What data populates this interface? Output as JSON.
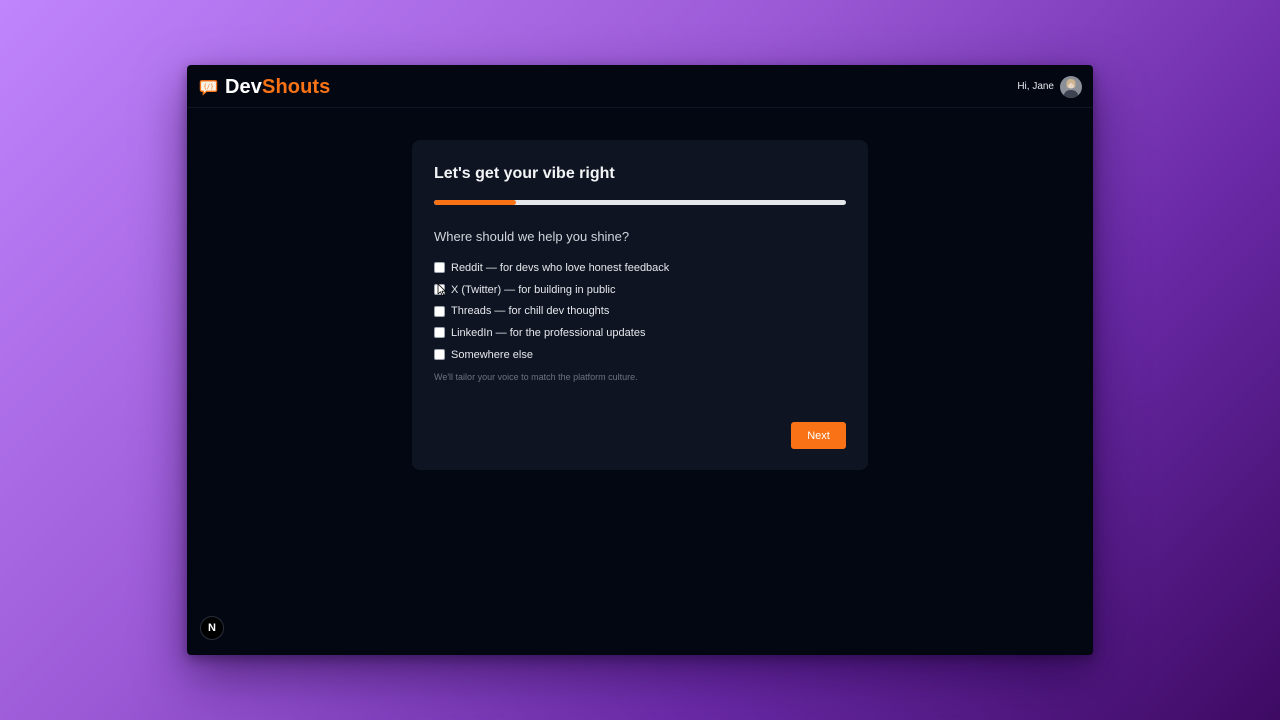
{
  "header": {
    "brand_part1": "Dev",
    "brand_part2": "Shouts",
    "brand_icon": "speech-bubble-code-icon",
    "greeting": "Hi, Jane",
    "avatar_icon": "user-avatar"
  },
  "onboarding": {
    "title": "Let's get your vibe right",
    "progress": 0.2,
    "question": "Where should we help you shine?",
    "options": [
      {
        "label": "Reddit — for devs who love honest feedback",
        "checked": false
      },
      {
        "label": "X (Twitter) — for building in public",
        "checked": false
      },
      {
        "label": "Threads — for chill dev thoughts",
        "checked": false
      },
      {
        "label": "LinkedIn — for the professional updates",
        "checked": false
      },
      {
        "label": "Somewhere else",
        "checked": false
      }
    ],
    "hint": "We'll tailor your voice to match the platform culture.",
    "next_label": "Next"
  },
  "footer": {
    "badge_letter": "N"
  },
  "colors": {
    "accent": "#f97316",
    "window_bg": "#030712",
    "card_bg": "#0f1422"
  }
}
